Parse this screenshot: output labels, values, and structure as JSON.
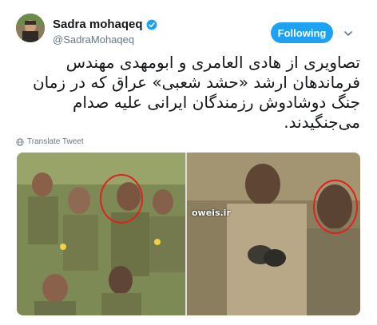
{
  "author": {
    "display_name": "Sadra mohaqeq",
    "handle": "@SadraMohaqeq",
    "verified": true
  },
  "follow_button": {
    "label": "Following"
  },
  "menu": {
    "icon": "chevron-down-icon"
  },
  "tweet": {
    "lines": [
      "تصاویری از هادی العامری و ابومهدی مهندس",
      "فرماندهان ارشد «حشد شعبی» عراق که در زمان",
      "جنگ دوشادوش رزمندگان ایرانی علیه صدام",
      "می‌جنگیدند."
    ]
  },
  "translate": {
    "label": "Translate Tweet",
    "icon": "globe-icon"
  },
  "media": {
    "watermark": "oweis.ir"
  },
  "colors": {
    "accent": "#1da1f2",
    "text": "#14171a",
    "secondary": "#657786",
    "highlight_circle": "#e0201c"
  }
}
